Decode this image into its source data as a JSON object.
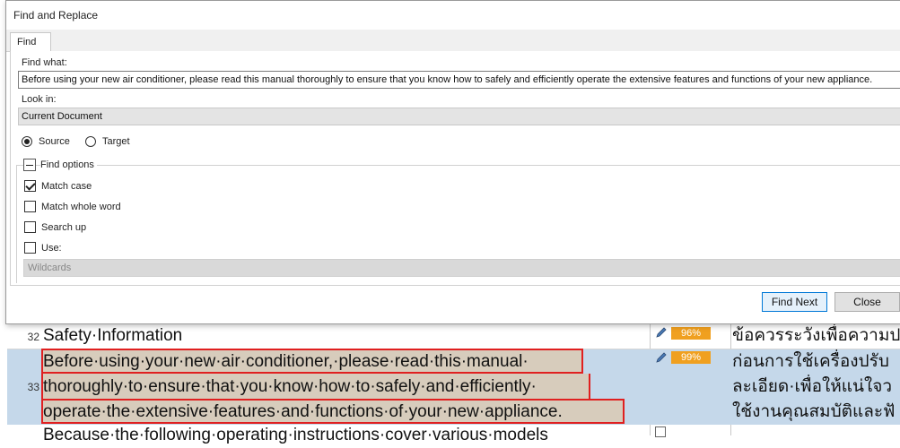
{
  "dialog": {
    "title": "Find and Replace",
    "tab": "Find",
    "find_label": "Find what:",
    "find_value": "Before using your new air conditioner, please read this manual thoroughly to ensure that you know how to safely and efficiently operate the extensive features and functions of your new appliance.",
    "look_in_label": "Look in:",
    "look_in_value": "Current Document",
    "source_label": "Source",
    "target_label": "Target",
    "find_options_label": "Find options",
    "match_case_label": "Match case",
    "match_whole_word_label": "Match whole word",
    "search_up_label": "Search up",
    "use_label": "Use:",
    "wildcards_value": "Wildcards",
    "find_next_label": "Find Next",
    "close_label": "Close"
  },
  "editor": {
    "rows": [
      {
        "num": "32",
        "source": "Safety·Information",
        "match": "96%",
        "target": "ข้อควรระวังเพื่อความป"
      },
      {
        "num": "33",
        "source_lines": [
          "Before·using·your·new·air·conditioner,·please·read·this·manual·",
          "thoroughly·to·ensure·that·you·know·how·to·safely·and·efficiently·",
          "operate·the·extensive·features·and·functions·of·your·new·appliance."
        ],
        "match": "99%",
        "target_lines": [
          "ก่อนการใช้เครื่องปรับ",
          "ละเอียด·เพื่อให้แน่ใจว",
          "ใช้งานคุณสมบัติและฟั"
        ]
      },
      {
        "source": "Because·the·following·operating·instructions·cover·various·models"
      }
    ]
  },
  "colors": {
    "match_badge": "#f0a020",
    "selected_row": "#c5d8ea",
    "highlight_border": "#e02020"
  }
}
